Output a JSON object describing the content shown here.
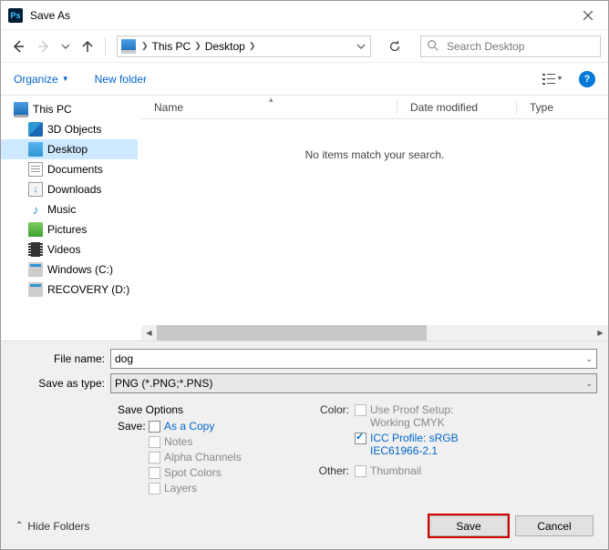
{
  "title": "Save As",
  "breadcrumb": {
    "root": "This PC",
    "loc": "Desktop"
  },
  "search": {
    "placeholder": "Search Desktop"
  },
  "toolbar": {
    "organize": "Organize",
    "newfolder": "New folder"
  },
  "tree": {
    "root": "This PC",
    "items": [
      "3D Objects",
      "Desktop",
      "Documents",
      "Downloads",
      "Music",
      "Pictures",
      "Videos",
      "Windows (C:)",
      "RECOVERY (D:)"
    ]
  },
  "columns": {
    "name": "Name",
    "date": "Date modified",
    "type": "Type"
  },
  "empty_text": "No items match your search.",
  "filename_label": "File name:",
  "filename_value": "dog",
  "filetype_label": "Save as type:",
  "filetype_value": "PNG (*.PNG;*.PNS)",
  "options": {
    "title": "Save Options",
    "save_label": "Save:",
    "as_copy": "As a Copy",
    "notes": "Notes",
    "alpha": "Alpha Channels",
    "spot": "Spot Colors",
    "layers": "Layers",
    "color_label": "Color:",
    "proof": "Use Proof Setup:",
    "proof2": "Working CMYK",
    "icc": "ICC Profile: sRGB",
    "icc2": "IEC61966-2.1",
    "other_label": "Other:",
    "thumb": "Thumbnail"
  },
  "hide_folders": "Hide Folders",
  "save_btn": "Save",
  "cancel_btn": "Cancel"
}
